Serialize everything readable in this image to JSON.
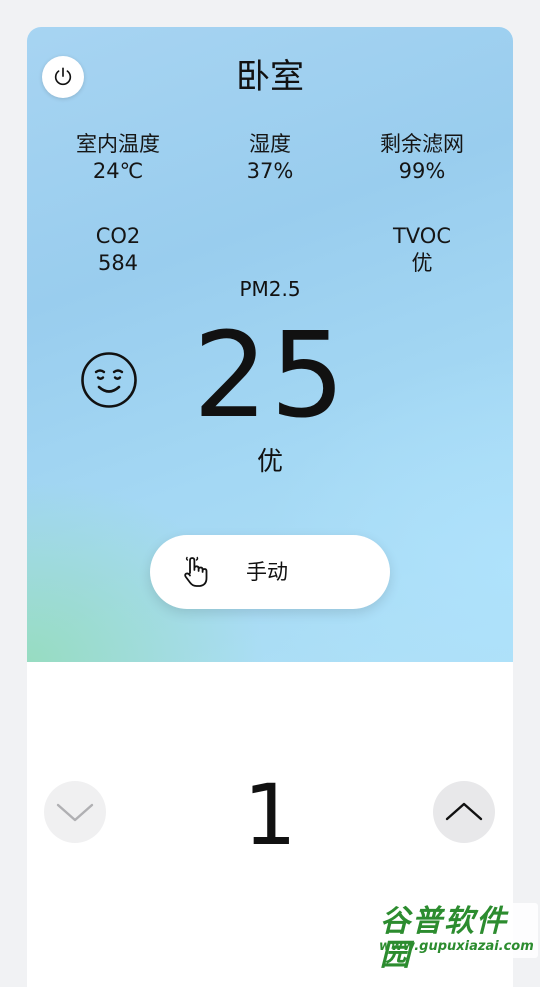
{
  "room": {
    "title": "卧室"
  },
  "stats": {
    "indoor_temp": {
      "label": "室内温度",
      "value": "24℃"
    },
    "humidity": {
      "label": "湿度",
      "value": "37%"
    },
    "filter_left": {
      "label": "剩余滤网",
      "value": "99%"
    },
    "co2": {
      "label": "CO2",
      "value": "584"
    },
    "tvoc": {
      "label": "TVOC",
      "value": "优"
    }
  },
  "pm25": {
    "label": "PM2.5",
    "value": "25",
    "quality": "优"
  },
  "mode": {
    "label": "手动"
  },
  "fan_speed": {
    "value": "1"
  },
  "watermark": {
    "title": "谷普软件园",
    "url": "www.gupuxiazai.com"
  },
  "colors": {
    "hero_blue": "#9fd2f0",
    "hero_green": "#96dcbe",
    "watermark_green": "#2c8c2f"
  }
}
